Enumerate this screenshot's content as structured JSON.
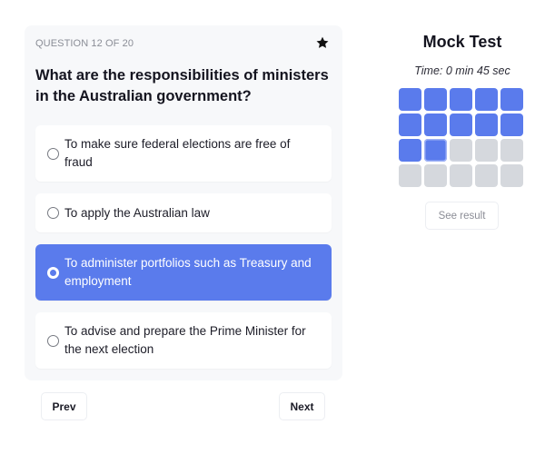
{
  "question": {
    "counter": "QUESTION 12 OF 20",
    "title": "What are the responsibilities of ministers in the Australian government?",
    "bookmark_icon": "star-icon",
    "options": [
      {
        "label": "To make sure federal elections are free of fraud",
        "selected": false
      },
      {
        "label": "To apply the Australian law",
        "selected": false
      },
      {
        "label": "To administer portfolios such as Treasury and employment",
        "selected": true
      },
      {
        "label": "To advise and prepare the Prime Minister for the next election",
        "selected": false
      }
    ]
  },
  "navigation": {
    "prev_label": "Prev",
    "next_label": "Next"
  },
  "sidebar": {
    "title": "Mock Test",
    "timer": "Time: 0 min 45 sec",
    "total_questions": 20,
    "answered_count": 12,
    "current_question": 12,
    "see_result_label": "See result"
  },
  "colors": {
    "accent": "#5a7bec",
    "unanswered": "#d5d8dd",
    "card_bg": "#f7f8fa"
  }
}
